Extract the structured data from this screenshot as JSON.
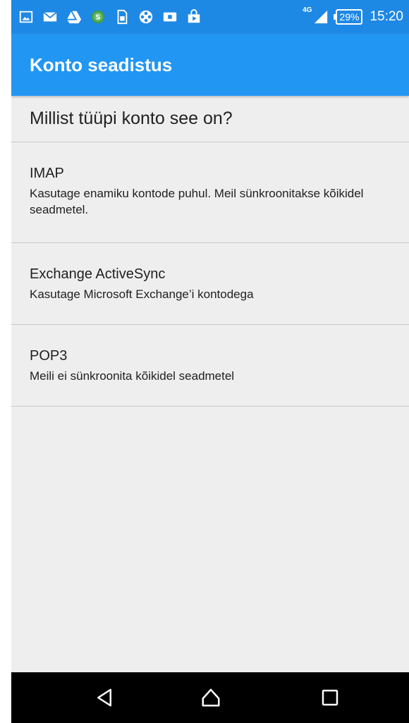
{
  "status_bar": {
    "left_icons": [
      "image-icon",
      "mail-icon",
      "drive-icon",
      "money-icon",
      "sim-icon",
      "media-icon",
      "cast-icon",
      "shop-icon"
    ],
    "network_type": "4G",
    "battery": "29%",
    "time": "15:20"
  },
  "app_bar": {
    "title": "Konto seadistus"
  },
  "content": {
    "heading": "Millist tüüpi konto see on?",
    "options": [
      {
        "title": "IMAP",
        "description": "Kasutage enamiku kontode puhul. Meil sünkroonitakse kõikidel seadmetel."
      },
      {
        "title": "Exchange ActiveSync",
        "description": "Kasutage Microsoft Exchange’i kontodega"
      },
      {
        "title": "POP3",
        "description": "Meili ei sünkroonita kõikidel seadmetel"
      }
    ]
  },
  "nav_bar": {
    "buttons": [
      "back-icon",
      "home-icon",
      "recent-apps-icon"
    ]
  },
  "colors": {
    "status_bar": "#1e88e5",
    "app_bar": "#2196f3",
    "background": "#eeeeee",
    "divider": "#c8c8c8",
    "nav_bar": "#000000"
  }
}
